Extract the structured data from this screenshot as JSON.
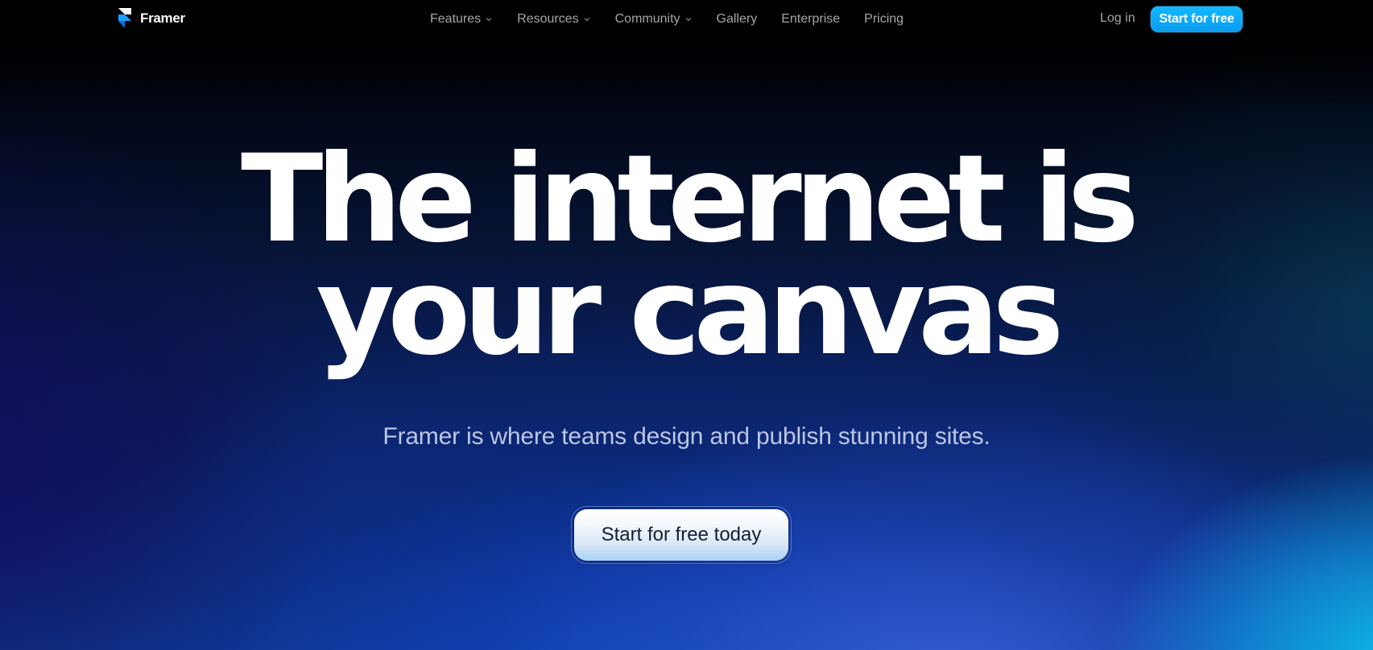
{
  "brand": {
    "name": "Framer",
    "logo_icon": "framer-logo-icon",
    "colors": {
      "accent": "#0a9cf0",
      "logo_top": "#ffffff",
      "logo_mid": "#18a0fb",
      "logo_bottom": "#0d6ee0"
    }
  },
  "nav": {
    "links": [
      {
        "label": "Features",
        "has_dropdown": true,
        "icon": "chevron-down-icon"
      },
      {
        "label": "Resources",
        "has_dropdown": true,
        "icon": "chevron-down-icon"
      },
      {
        "label": "Community",
        "has_dropdown": true,
        "icon": "chevron-down-icon"
      },
      {
        "label": "Gallery",
        "has_dropdown": false
      },
      {
        "label": "Enterprise",
        "has_dropdown": false
      },
      {
        "label": "Pricing",
        "has_dropdown": false
      }
    ],
    "login_label": "Log in",
    "cta_label": "Start for free"
  },
  "hero": {
    "title_line1": "The internet is",
    "title_line2": "your canvas",
    "subtitle": "Framer is where teams design and publish stunning sites.",
    "cta_label": "Start for free today"
  }
}
